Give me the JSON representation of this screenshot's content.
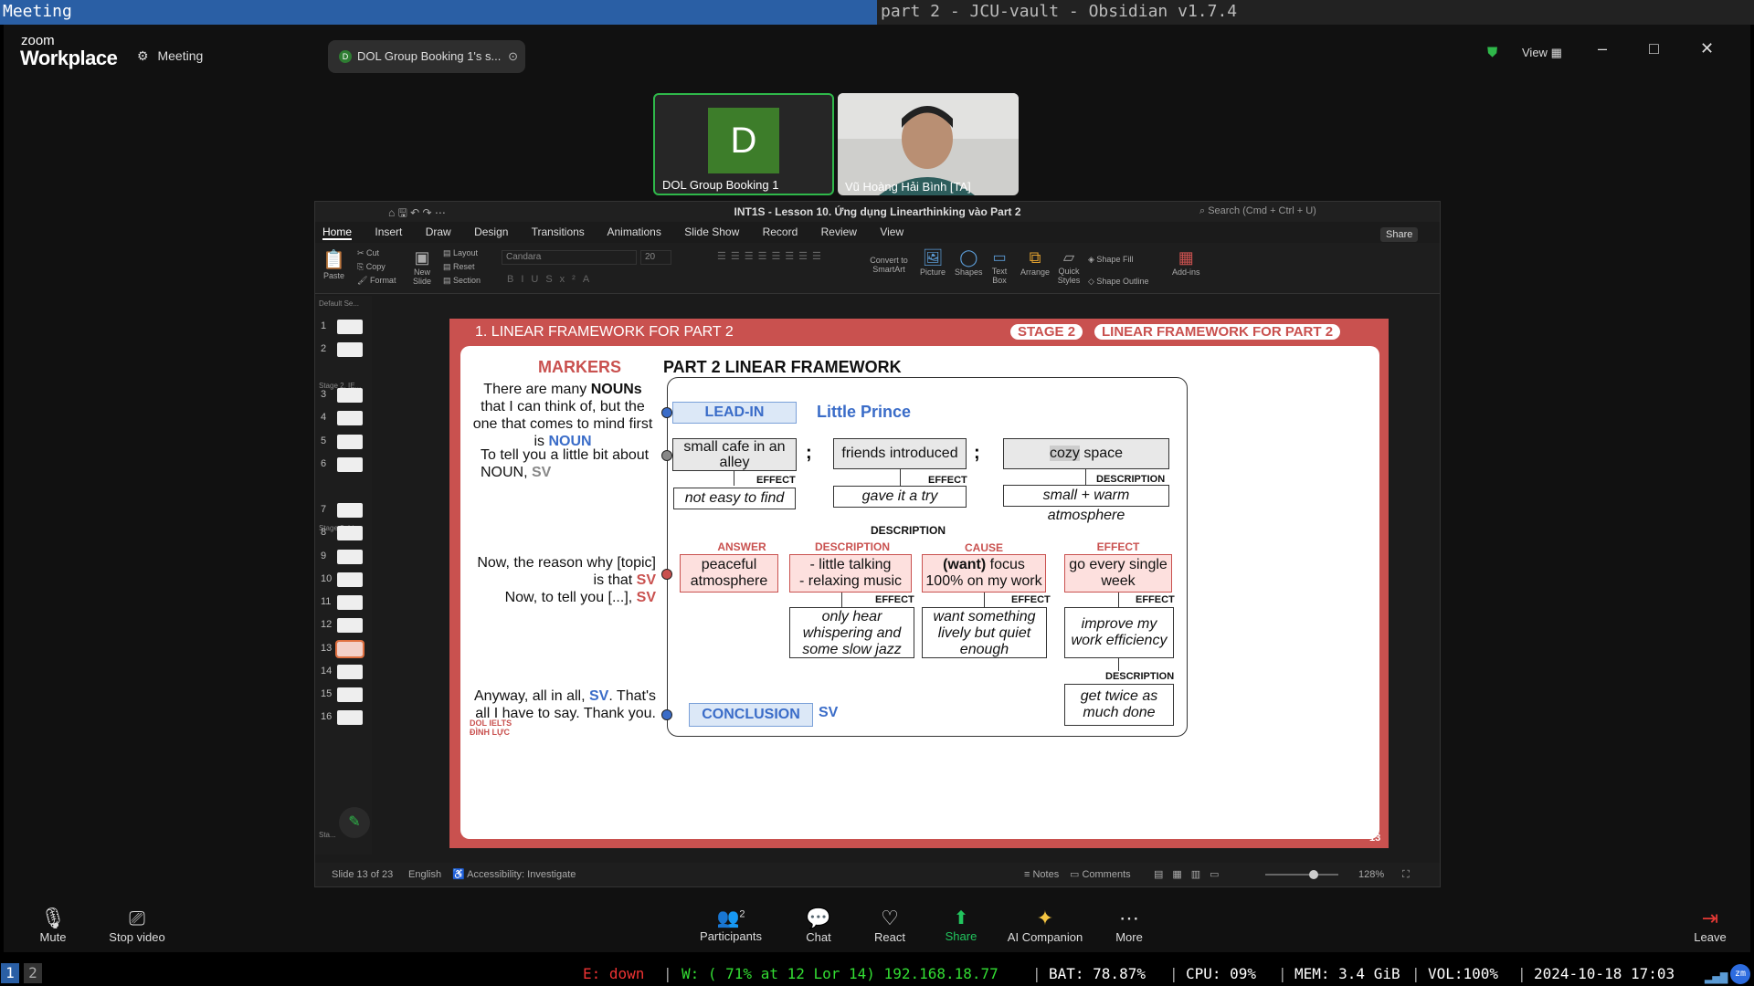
{
  "wm": {
    "left_title": "Meeting",
    "right_title": "part 2 - JCU-vault - Obsidian v1.7.4"
  },
  "zoom": {
    "brand_small": "zoom",
    "brand_big": "Workplace",
    "meeting_label": "Meeting",
    "share_pill": "DOL Group Booking 1's s...",
    "share_pill_initial": "D",
    "view_label": "View",
    "tiles": [
      {
        "name": "DOL Group Booking 1",
        "initial": "D"
      },
      {
        "name": "Vũ Hoàng Hải Bình [TA]"
      }
    ],
    "controls": {
      "mute": "Mute",
      "video": "Stop video",
      "participants": "Participants",
      "participants_count": "2",
      "chat": "Chat",
      "react": "React",
      "share": "Share",
      "companion": "AI Companion",
      "more": "More",
      "leave": "Leave"
    }
  },
  "ppt": {
    "title": "INT1S - Lesson 10. Ứng dụng Linearthinking vào Part 2",
    "search": "Search (Cmd + Ctrl + U)",
    "share": "Share",
    "tabs": [
      "Home",
      "Insert",
      "Draw",
      "Design",
      "Transitions",
      "Animations",
      "Slide Show",
      "Record",
      "Review",
      "View"
    ],
    "ribbon": {
      "paste": "Paste",
      "cut": "Cut",
      "copy": "Copy",
      "format": "Format",
      "new_slide": "New Slide",
      "layout": "Layout",
      "reset": "Reset",
      "section": "Section",
      "font": "Candara",
      "size": "20",
      "convert": "Convert to SmartArt",
      "picture": "Picture",
      "shapes": "Shapes",
      "textbox": "Text Box",
      "arrange": "Arrange",
      "quick": "Quick Styles",
      "fill": "Shape Fill",
      "outline": "Shape Outline",
      "addins": "Add-ins"
    },
    "sections": [
      "Default Se...",
      "Stage 2. IE...",
      "Stage 2. Li...",
      "Sta..."
    ],
    "slide_numbers": [
      "1",
      "2",
      "3",
      "4",
      "5",
      "6",
      "7",
      "8",
      "9",
      "10",
      "11",
      "12",
      "13",
      "14",
      "15",
      "16"
    ],
    "status": {
      "slide": "Slide 13 of 23",
      "lang": "English",
      "access": "Accessibility: Investigate",
      "notes": "Notes",
      "comments": "Comments",
      "zoom": "128%"
    }
  },
  "slide": {
    "header_left": "1. LINEAR FRAMEWORK FOR PART 2",
    "stage": "STAGE 2",
    "header_right": "LINEAR FRAMEWORK FOR PART 2",
    "markers": "MARKERS",
    "framework": "PART 2 LINEAR FRAMEWORK",
    "m1a": "There are many ",
    "m1b": "NOUNs",
    "m1c": " that I can think of, but the one that comes to mind first is ",
    "m1d": "NOUN",
    "m2a": "To tell you a little bit about NOUN, ",
    "m2b": "SV",
    "m3a": "Now, the reason why [topic] is that ",
    "m3b": "SV",
    "m3c": "Now, to tell you [...], ",
    "m3d": "SV",
    "m4a": "Anyway, all in all, ",
    "m4b": "SV",
    "m4c": ". That's all I have to say. Thank you.",
    "leadin": "LEAD-IN",
    "little_prince": "Little Prince",
    "b1": "small cafe in an alley",
    "b2": "friends introduced",
    "b3a": "cozy",
    "b3b": " space",
    "effect": "EFFECT",
    "description": "DESCRIPTION",
    "e1": "not easy to find",
    "e2": "gave it a try",
    "e3": "small + warm atmosphere",
    "desc_center": "DESCRIPTION",
    "r_answer": "ANSWER",
    "r_desc": "DESCRIPTION",
    "r_cause": "CAUSE",
    "r_effect": "EFFECT",
    "c1": "peaceful atmosphere",
    "c2a": "- little talking",
    "c2b": "- relaxing music",
    "c3a": "(want)",
    "c3b": " focus 100% on my work",
    "c4": "go every single week",
    "d2": "only hear whispering and some slow jazz",
    "d3": "want something lively but quiet enough",
    "d4": "improve my work efficiency",
    "f4": "get twice as much done",
    "conclusion": "CONCLUSION",
    "concl_sv": "SV",
    "logo": "DOL IELTS ĐÌNH LỰC",
    "page": "13"
  },
  "i3": {
    "ws1": "1",
    "ws2": "2",
    "eth": "E: down",
    "wifi": "W: ( 71% at 12 Lor 14) 192.168.18.77",
    "bat": "BAT: 78.87%",
    "cpu": "CPU: 09%",
    "mem": "MEM: 3.4 GiB",
    "vol": "VOL:100%",
    "time": "2024-10-18 17:03"
  },
  "colors": {
    "accent_red": "#c9514f",
    "accent_blue": "#3a6cc8",
    "zoom_green": "#2fb84a",
    "share_green": "#22c55e"
  }
}
